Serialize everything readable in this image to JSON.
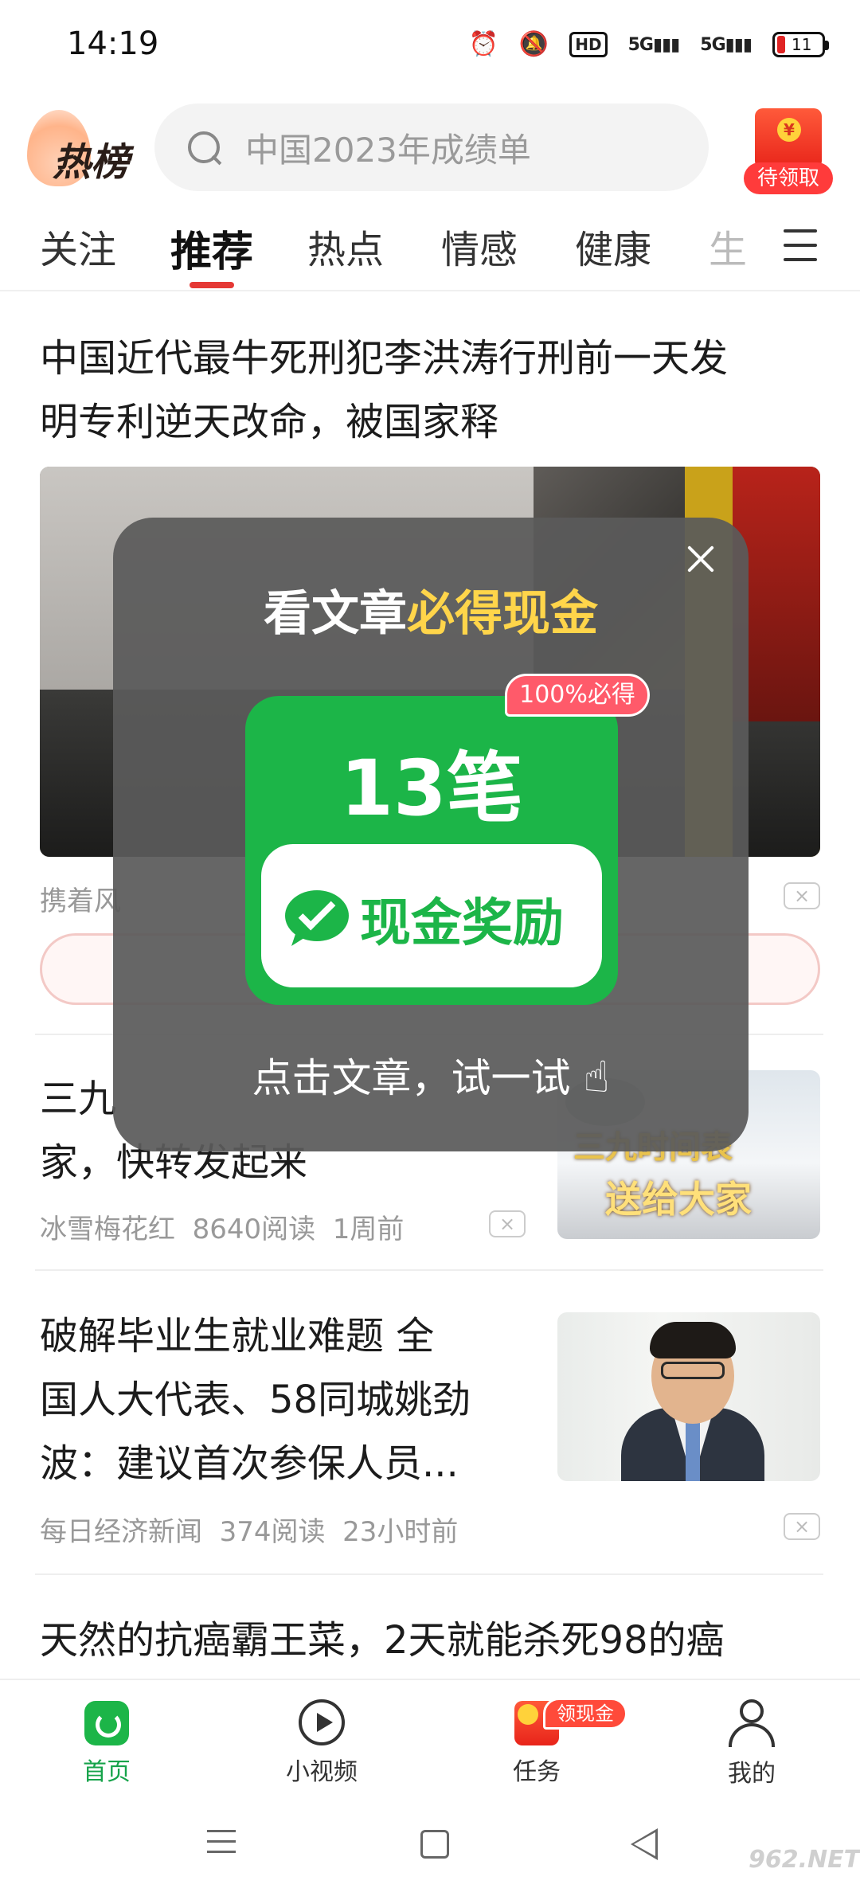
{
  "status_bar": {
    "time": "14:19",
    "hd": "HD",
    "signal1": "5G",
    "signal2": "5G",
    "battery": "11"
  },
  "header": {
    "logo_text": "热榜",
    "search_placeholder": "中国2023年成绩单",
    "redpack_label": "待领取",
    "redpack_coin": "¥"
  },
  "tabs": [
    {
      "label": "关注"
    },
    {
      "label": "推荐"
    },
    {
      "label": "热点"
    },
    {
      "label": "情感"
    },
    {
      "label": "健康"
    },
    {
      "label": "生"
    }
  ],
  "feed": {
    "article1": {
      "title_line1": "中国近代最牛死刑犯李洪涛行刑前一天发",
      "title_line2": "明专利逆天改命，被国家释",
      "source_partial": "携着风"
    },
    "article2": {
      "title_line1": "三九",
      "title_line2": "家，快转发起来",
      "source": "冰雪梅花红",
      "reads": "8640阅读",
      "time": "1周前",
      "thumb_cap1": "三九",
      "thumb_cap1_b": "时间表",
      "thumb_cap2": "送给大家"
    },
    "article3": {
      "title_line1": "破解毕业生就业难题 全",
      "title_line2": "国人大代表、58同城姚劲",
      "title_line3": "波：建议首次参保人员...",
      "source": "每日经济新闻",
      "reads": "374阅读",
      "time": "23小时前"
    },
    "article4": {
      "title_line1": "天然的抗癌霸王菜，2天就能杀死98的癌"
    },
    "dismiss_glyph": "×"
  },
  "popup": {
    "title_plain": "看文章",
    "title_highlight": "必得现金",
    "badge": "100%必得",
    "count": "13笔",
    "reward": "现金奖励",
    "hint": "点击文章，试一试",
    "hand_icon": "☝"
  },
  "bottom_nav": [
    {
      "label": "首页"
    },
    {
      "label": "小视频"
    },
    {
      "label": "任务",
      "badge": "领现金"
    },
    {
      "label": "我的"
    }
  ],
  "watermark": "962.NET",
  "colors": {
    "accent_red": "#e53935",
    "brand_green": "#1cb548",
    "highlight_yellow": "#ffd54a"
  }
}
